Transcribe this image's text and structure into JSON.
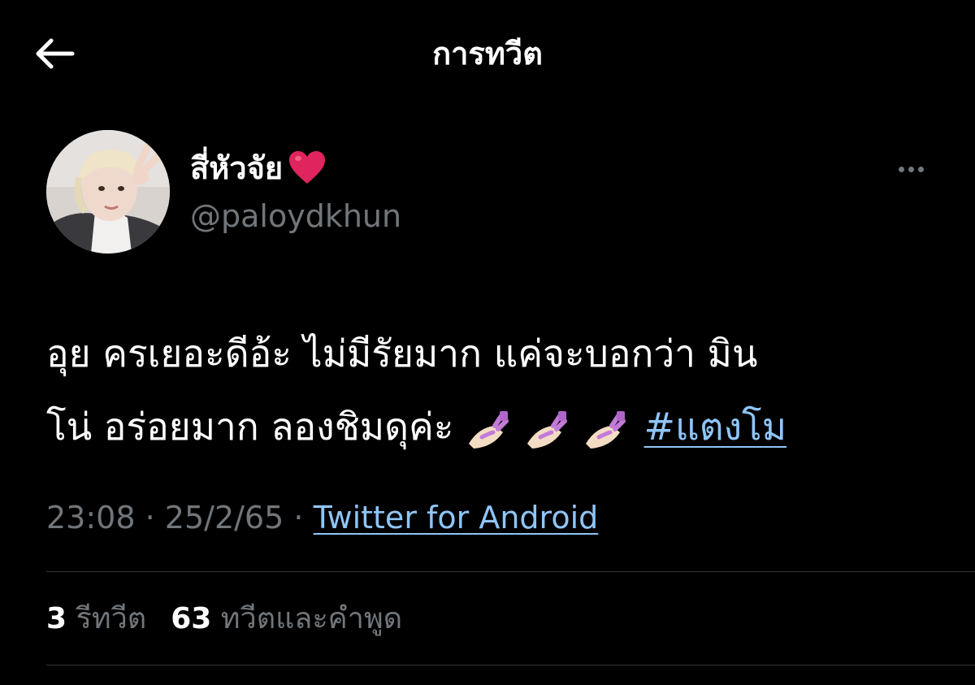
{
  "header": {
    "title": "การทวีต",
    "back_icon": "arrow-left-icon"
  },
  "author": {
    "display_name": "สี่หัวจัย",
    "name_emoji": "heart-icon",
    "handle": "@paloydkhun",
    "more_icon": "more-horizontal-icon"
  },
  "tweet": {
    "line1": "อุย ครเยอะดีอ้ะ ไม่มีรัยมาก แค่จะบอกว่า มิน",
    "line2": "โน่ อร่อยมาก ลองชิมดุค่ะ",
    "emoji": [
      "nail-polish-icon",
      "nail-polish-icon",
      "nail-polish-icon"
    ],
    "hashtag": "#แตงโม"
  },
  "meta": {
    "time": "23:08",
    "date": "25/2/65",
    "separator": "·",
    "source": "Twitter for Android"
  },
  "stats": {
    "retweets_count": "3",
    "retweets_label": "รีทวีต",
    "quotes_count": "63",
    "quotes_label": "ทวีตและคำพูด"
  },
  "colors": {
    "background": "#000000",
    "text": "#ffffff",
    "secondary": "#71767b",
    "link": "#8fc5f7",
    "divider": "#2f3336",
    "heart": "#e0245e",
    "nail_polish": "#c27bd8"
  }
}
